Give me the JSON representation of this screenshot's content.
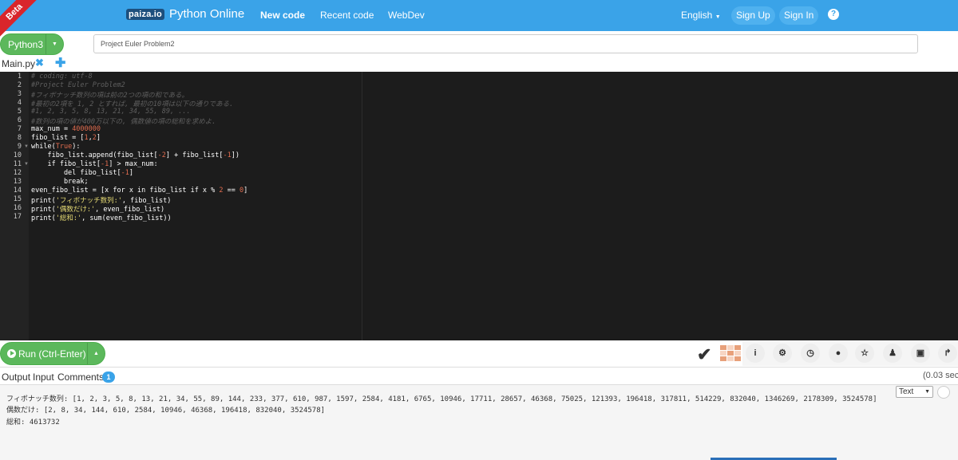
{
  "header": {
    "beta": "Beta",
    "logo": "paiza.io",
    "title": "Python Online",
    "nav": [
      "New code",
      "Recent code",
      "WebDev"
    ],
    "language": "English",
    "sign_up": "Sign Up",
    "sign_in": "Sign In",
    "help": "?"
  },
  "toolbar": {
    "language": "Python3",
    "project_title": "Project Euler Problem2"
  },
  "file_tab": {
    "name": "Main.py",
    "close": "✖",
    "add": "✚"
  },
  "editor": {
    "line_numbers": [
      "1",
      "2",
      "3",
      "4",
      "5",
      "6",
      "7",
      "8",
      "9",
      "10",
      "11",
      "12",
      "13",
      "14",
      "15",
      "16",
      "17"
    ]
  },
  "run": {
    "label": "Run (Ctrl-Enter)"
  },
  "output_tabs": {
    "output": "Output",
    "input": "Input",
    "comments": "Comments",
    "comments_count": "1",
    "exec_time": "(0.03 sec"
  },
  "output": {
    "format": "Text",
    "lines": [
      "フィボナッチ数列: [1, 2, 3, 5, 8, 13, 21, 34, 55, 89, 144, 233, 377, 610, 987, 1597, 2584, 4181, 6765, 10946, 17711, 28657, 46368, 75025, 121393, 196418, 317811, 514229, 832040, 1346269, 2178309, 3524578]",
      "偶数だけ: [2, 8, 34, 144, 610, 2584, 10946, 46368, 196418, 832040, 3524578]",
      "総和: 4613732"
    ]
  }
}
